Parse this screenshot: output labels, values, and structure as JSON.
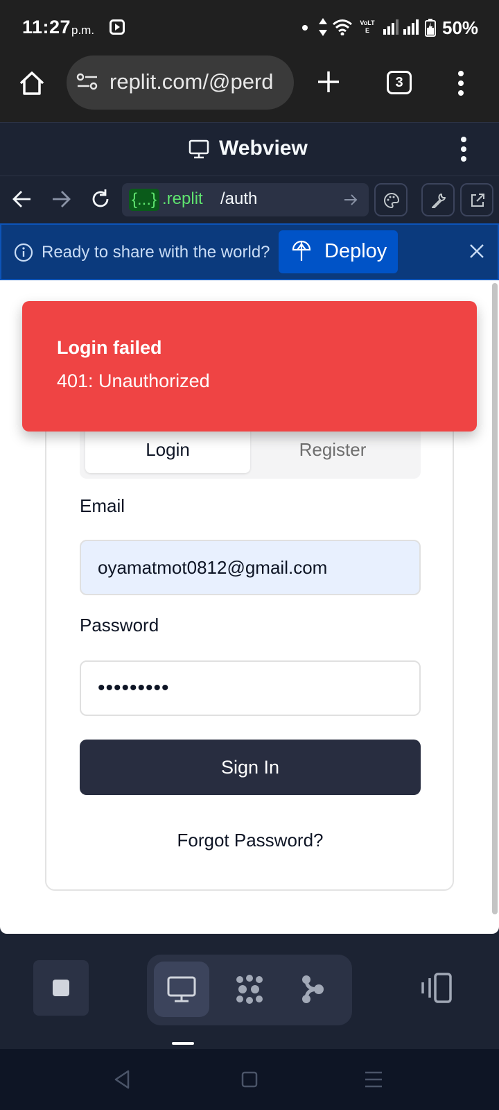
{
  "status_bar": {
    "time": "11:27",
    "ampm": "p.m.",
    "network": "VoLTE",
    "battery": "50%",
    "icons": [
      "media-notification-icon",
      "dot-icon",
      "data-arrows-icon",
      "wifi-icon",
      "volte-icon",
      "signal-icon",
      "signal-icon",
      "battery-icon"
    ]
  },
  "browser": {
    "url": "replit.com/@perd",
    "tab_count": "3",
    "icons": [
      "home-icon",
      "site-settings-icon",
      "new-tab-icon",
      "tab-switcher-icon",
      "menu-icon"
    ]
  },
  "webview_header": {
    "title": "Webview"
  },
  "address_bar": {
    "code_badge": "{...}",
    "domain": ".replit",
    "path": "/auth"
  },
  "deploy_banner": {
    "message": "Ready to share with the world?",
    "button": "Deploy"
  },
  "toast": {
    "title": "Login failed",
    "description": "401: Unauthorized",
    "color": "#ef4444"
  },
  "auth": {
    "tabs": [
      {
        "label": "Login",
        "active": true
      },
      {
        "label": "Register",
        "active": false
      }
    ],
    "email_label": "Email",
    "email_value": "oyamatmot0812@gmail.com",
    "password_label": "Password",
    "password_value": "•••••••••",
    "submit": "Sign In",
    "forgot": "Forgot Password?"
  },
  "bottom_nav": {
    "active": "webview",
    "items": [
      "stop-icon",
      "webview-icon",
      "agent-icon",
      "tools-icon",
      "split-view-icon"
    ]
  },
  "colors": {
    "replit_bg": "#1c2333",
    "deploy_bg": "#0b3a7d",
    "button_dark": "#282d40",
    "code_green": "#5fe36f"
  }
}
